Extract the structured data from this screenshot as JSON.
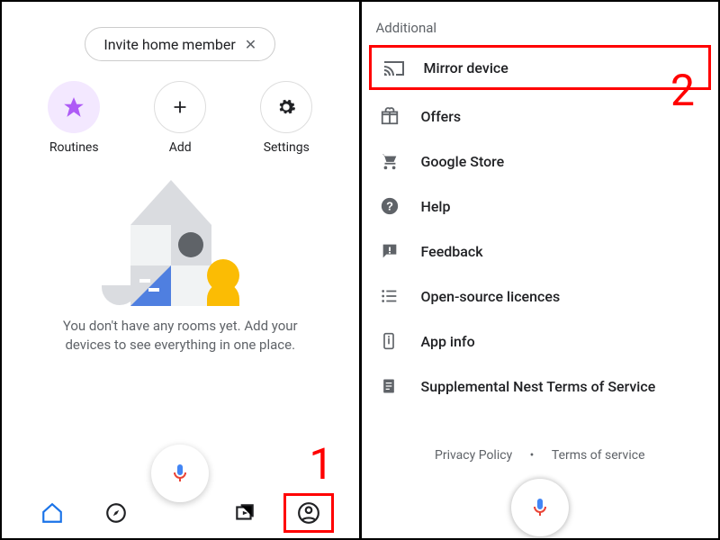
{
  "left": {
    "invite_label": "Invite home member",
    "actions": {
      "routines_label": "Routines",
      "add_label": "Add",
      "settings_label": "Settings"
    },
    "empty_msg": "You don't have any rooms yet. Add your devices to see everything in one place."
  },
  "right": {
    "heading": "Additional",
    "items": {
      "mirror": "Mirror device",
      "offers": "Offers",
      "store": "Google Store",
      "help": "Help",
      "feedback": "Feedback",
      "licences": "Open-source licences",
      "appinfo": "App info",
      "nest": "Supplemental Nest Terms of Service"
    },
    "footer": {
      "privacy": "Privacy Policy",
      "terms": "Terms of service"
    }
  },
  "annotations": {
    "one": "1",
    "two": "2"
  }
}
